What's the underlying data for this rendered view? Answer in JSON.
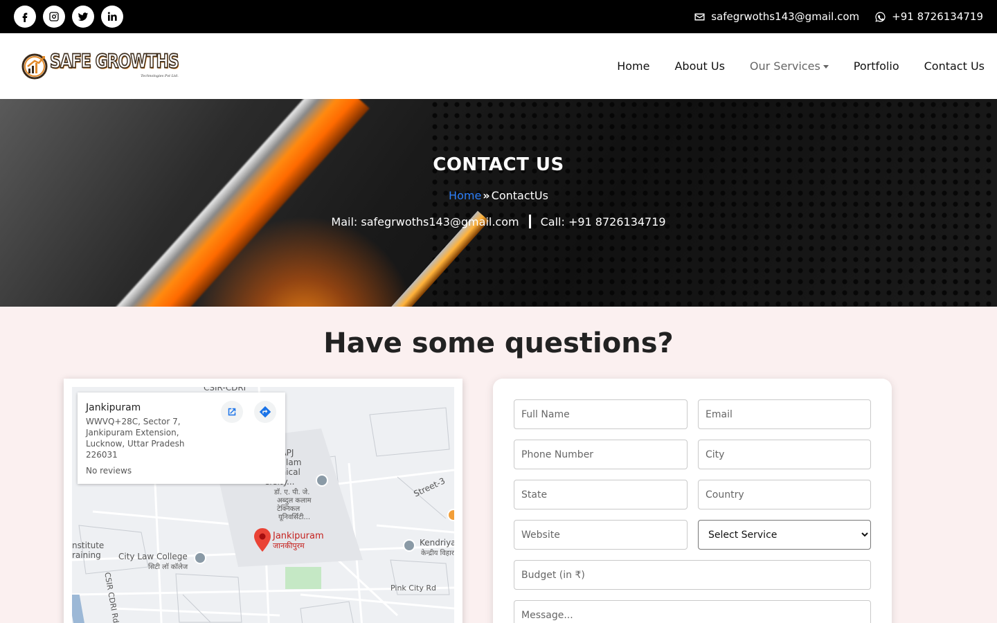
{
  "topbar": {
    "socials": [
      {
        "icon": "facebook-icon"
      },
      {
        "icon": "instagram-icon"
      },
      {
        "icon": "twitter-icon"
      },
      {
        "icon": "linkedin-icon"
      }
    ],
    "email": "safegrwoths143@gmail.com",
    "phone": "+91 8726134719"
  },
  "navbar": {
    "logo_name": "SAFE GROWTHS",
    "logo_sub": "Technologies Pvt Ltd.",
    "links": {
      "home": "Home",
      "about": "About Us",
      "services": "Our Services",
      "portfolio": "Portfolio",
      "contact": "Contact Us"
    }
  },
  "hero": {
    "title": "CONTACT US",
    "breadcrumb_home": "Home",
    "breadcrumb_sep": "»",
    "breadcrumb_current": "ContactUs",
    "mail": "Mail: safegrwoths143@gmail.com",
    "call": "Call: +91 8726134719"
  },
  "section": {
    "title": "Have some questions?"
  },
  "map": {
    "place_name": "Jankipuram",
    "address": "WWVQ+28C, Sector 7, Jankipuram Extension, Lucknow, Uttar Pradesh 226031",
    "reviews": "No reviews",
    "labels": {
      "csir": "CSIR-CDRI",
      "apj1": "r. APJ",
      "apj2": "Kalam",
      "apj3": "hnical",
      "apj4": "ersity...",
      "hindi1": "डॉ. ए. पी. जे.",
      "hindi2": "अब्दुल कलाम",
      "hindi3": "टेक्निकल",
      "hindi4": "यूनिवर्सिटी...",
      "street3": "Street-3",
      "pin_en": "Jankipuram",
      "pin_hi": "जानकीपुरम",
      "kendriya_en": "Kendriya",
      "kendriya_hi": "केन्द्रीय विहार",
      "institute1": "nstitute",
      "institute2": "raining",
      "citylaw_en": "City Law College",
      "citylaw_hi": "सिटी लॉ कॉलेज",
      "pinkcity": "Pink City Rd",
      "csirrd": "CSIR CDRI Rd"
    }
  },
  "form": {
    "full_name": "Full Name",
    "email": "Email",
    "phone": "Phone Number",
    "city": "City",
    "state": "State",
    "country": "Country",
    "website": "Website",
    "service_selected": "Select Service",
    "budget": "Budget (in ₹)",
    "message": "Message..."
  }
}
